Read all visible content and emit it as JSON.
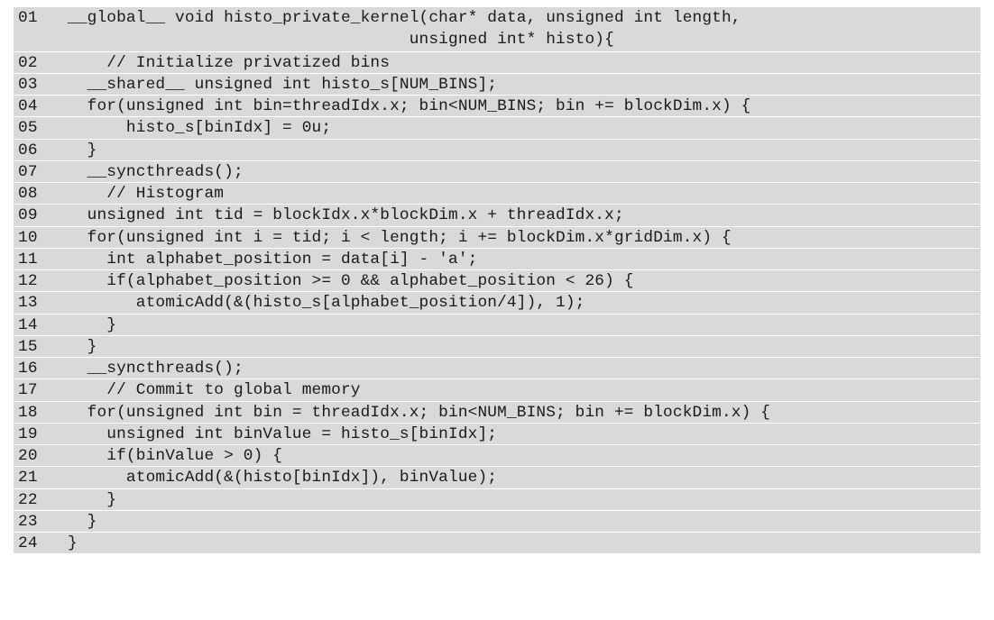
{
  "listing": {
    "lines": [
      {
        "num": "01",
        "code": "__global__ void histo_private_kernel(char* data, unsigned int length,"
      },
      {
        "num": "",
        "code": "                                   unsigned int* histo){"
      },
      {
        "num": "02",
        "code": "    // Initialize privatized bins"
      },
      {
        "num": "03",
        "code": "  __shared__ unsigned int histo_s[NUM_BINS];"
      },
      {
        "num": "04",
        "code": "  for(unsigned int bin=threadIdx.x; bin<NUM_BINS; bin += blockDim.x) {"
      },
      {
        "num": "05",
        "code": "      histo_s[binIdx] = 0u;"
      },
      {
        "num": "06",
        "code": "  }"
      },
      {
        "num": "07",
        "code": "  __syncthreads();"
      },
      {
        "num": "08",
        "code": "    // Histogram"
      },
      {
        "num": "09",
        "code": "  unsigned int tid = blockIdx.x*blockDim.x + threadIdx.x;"
      },
      {
        "num": "10",
        "code": "  for(unsigned int i = tid; i < length; i += blockDim.x*gridDim.x) {"
      },
      {
        "num": "11",
        "code": "    int alphabet_position = data[i] - 'a';"
      },
      {
        "num": "12",
        "code": "    if(alphabet_position >= 0 && alphabet_position < 26) {"
      },
      {
        "num": "13",
        "code": "       atomicAdd(&(histo_s[alphabet_position/4]), 1);"
      },
      {
        "num": "14",
        "code": "    }"
      },
      {
        "num": "15",
        "code": "  }"
      },
      {
        "num": "16",
        "code": "  __syncthreads();"
      },
      {
        "num": "17",
        "code": "    // Commit to global memory"
      },
      {
        "num": "18",
        "code": "  for(unsigned int bin = threadIdx.x; bin<NUM_BINS; bin += blockDim.x) {"
      },
      {
        "num": "19",
        "code": "    unsigned int binValue = histo_s[binIdx];"
      },
      {
        "num": "20",
        "code": "    if(binValue > 0) {"
      },
      {
        "num": "21",
        "code": "      atomicAdd(&(histo[binIdx]), binValue);"
      },
      {
        "num": "22",
        "code": "    }"
      },
      {
        "num": "23",
        "code": "  }"
      },
      {
        "num": "24",
        "code": "}"
      }
    ]
  }
}
